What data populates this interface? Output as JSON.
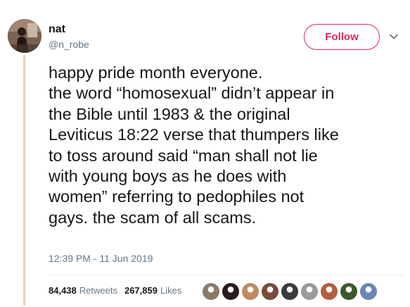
{
  "author": {
    "display_name": "nat",
    "handle": "@n_robe"
  },
  "header": {
    "follow_label": "Follow",
    "accent_color": "#e0245e"
  },
  "tweet": {
    "lines": [
      "happy pride month everyone.",
      "the word “homosexual” didn’t appear in",
      "the Bible until 1983 & the original",
      "Leviticus 18:22 verse that thumpers like",
      "to toss around said “man shall not lie",
      "with young boys as he does with",
      "women” referring to pedophiles not",
      "gays. the scam of all scams."
    ],
    "timestamp": "12:39 PM - 11 Jun 2019"
  },
  "stats": {
    "retweets_count": "84,438",
    "retweets_label": "Retweets",
    "likes_count": "267,859",
    "likes_label": "Likes"
  },
  "likers": [
    {
      "name": "liker-avatar-1",
      "color": "#8a7a6a"
    },
    {
      "name": "liker-avatar-2",
      "color": "#2b1a22"
    },
    {
      "name": "liker-avatar-3",
      "color": "#c08a60"
    },
    {
      "name": "liker-avatar-4",
      "color": "#7a4a3a"
    },
    {
      "name": "liker-avatar-5",
      "color": "#3a3a3a"
    },
    {
      "name": "liker-avatar-6",
      "color": "#9a9a9a"
    },
    {
      "name": "liker-avatar-7",
      "color": "#b06040"
    },
    {
      "name": "liker-avatar-8",
      "color": "#3a5a2a"
    },
    {
      "name": "liker-avatar-9",
      "color": "#6a88b0"
    }
  ]
}
